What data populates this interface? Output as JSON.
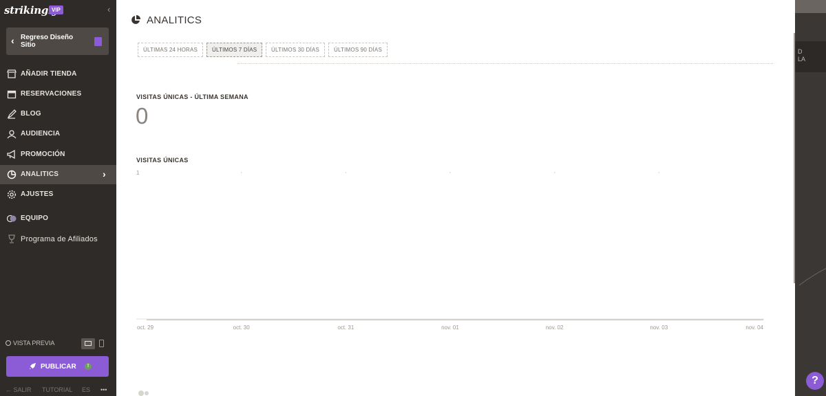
{
  "sidebar": {
    "logo": "strikingly",
    "vip_badge": "VIP",
    "back_button": "Regreso Diseño Sitio",
    "items": [
      {
        "label": "AÑADIR TIENDA",
        "icon": "store-icon"
      },
      {
        "label": "RESERVACIONES",
        "icon": "calendar-icon"
      },
      {
        "label": "BLOG",
        "icon": "pen-icon"
      },
      {
        "label": "AUDIENCIA",
        "icon": "people-icon"
      },
      {
        "label": "PROMOCIÓN",
        "icon": "megaphone-icon"
      },
      {
        "label": "ANALITICS",
        "icon": "pie-chart-icon",
        "active": true
      },
      {
        "label": "AJUSTES",
        "icon": "gear-icon"
      },
      {
        "label": "EQUIPO",
        "icon": "team-icon"
      },
      {
        "label": "Programa de Afiliados",
        "icon": "trophy-icon"
      }
    ],
    "preview_label": "VISTA PREVIA",
    "publish_label": "PUBLICAR",
    "publish_alert": "!",
    "footer": {
      "exit": "SALIR",
      "tutorial": "TUTORIAL",
      "lang": "ES",
      "more": "•••"
    },
    "accent": "#8c5bd6"
  },
  "main": {
    "title": "ANALITICS",
    "tabs": [
      "ÚLTIMAS 24 HORAS",
      "ÚLTIMOS 7 DÍAS",
      "ÚLTIMOS 30 DÍAS",
      "ÚLTIMOS 90 DÍAS"
    ],
    "active_tab": 1,
    "unique_visits_week_label": "VISITAS ÚNICAS - ÚLTIMA SEMANA",
    "unique_visits_week_value": "0",
    "chart_label": "VISITAS ÚNICAS"
  },
  "chart_data": {
    "type": "line",
    "title": "VISITAS ÚNICAS",
    "categories": [
      "oct. 29",
      "oct. 30",
      "oct. 31",
      "nov. 01",
      "nov. 02",
      "nov. 03",
      "nov. 04"
    ],
    "series": [
      {
        "values": [
          0,
          0,
          0,
          0,
          0,
          0,
          0
        ]
      }
    ],
    "y_tick_top": "1",
    "ylim": [
      0,
      1
    ]
  },
  "preview_strip": {
    "text": "D\nLA"
  },
  "help": "?"
}
